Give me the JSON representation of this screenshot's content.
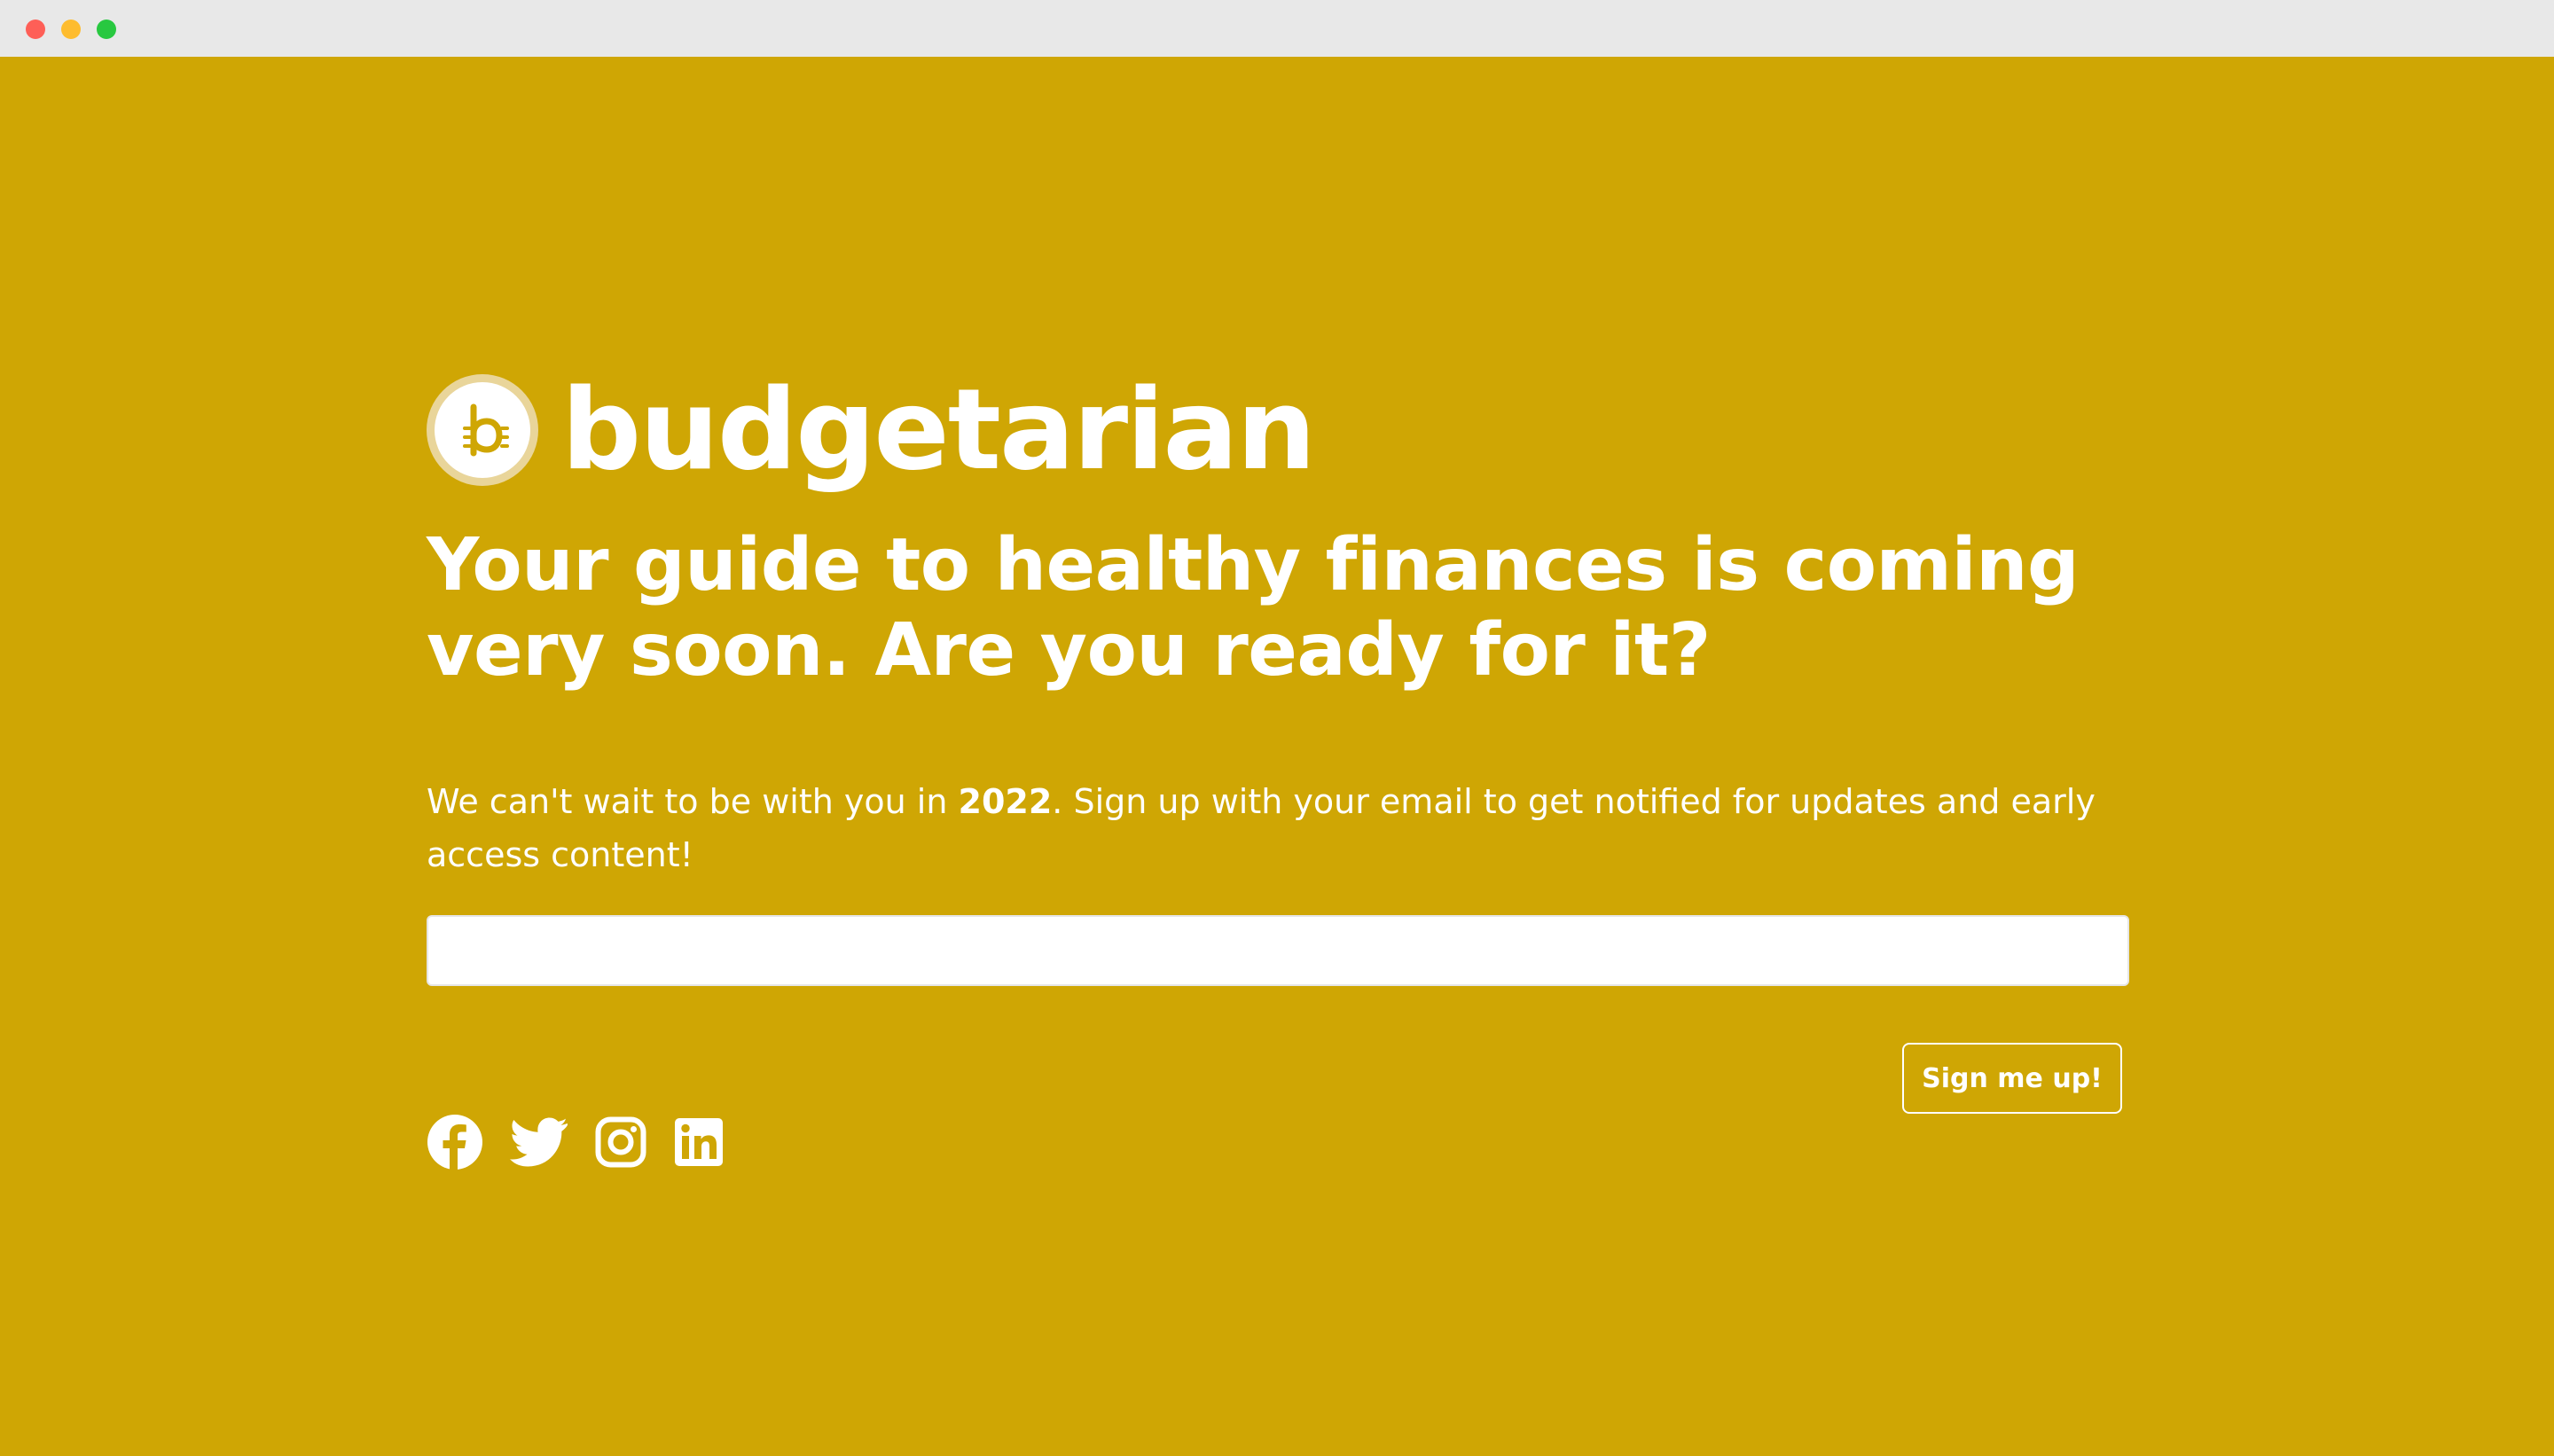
{
  "brand": {
    "name": "budgetarian",
    "logo_letter": "b",
    "color_accent": "#cfa604",
    "color_badge_ring": "#e9d59a"
  },
  "hero": {
    "headline_line1": "Your guide to healthy finances is coming",
    "headline_line2": "very soon. Are you ready for it?",
    "intro_before": "We can't wait to be with you in ",
    "intro_year": "2022",
    "intro_after": ". Sign up with your email to get notified for updates and early access content!"
  },
  "signup": {
    "email_value": "",
    "email_placeholder": "",
    "button_label": "Sign me up!"
  },
  "social": {
    "items": [
      {
        "name": "Facebook",
        "icon": "facebook-icon"
      },
      {
        "name": "Twitter",
        "icon": "twitter-icon"
      },
      {
        "name": "Instagram",
        "icon": "instagram-icon"
      },
      {
        "name": "LinkedIn",
        "icon": "linkedin-icon"
      }
    ]
  }
}
